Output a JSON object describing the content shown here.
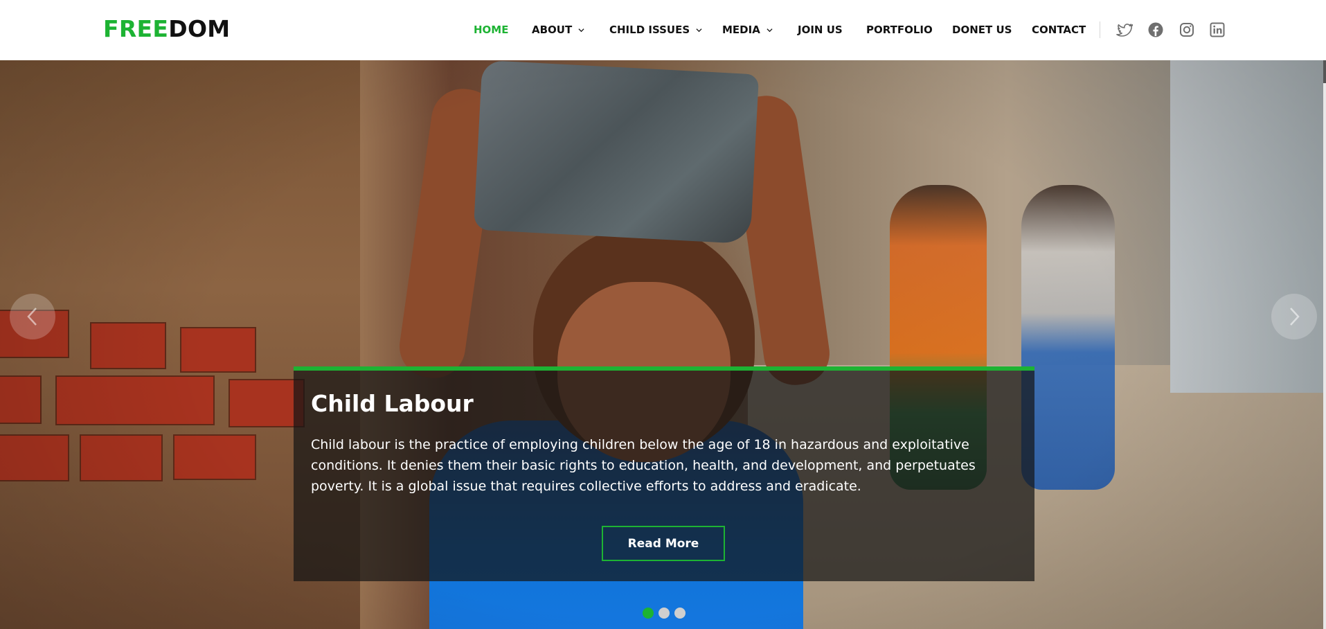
{
  "brand": {
    "part1": "FREE",
    "part2": "DOM",
    "accent": "#1db333"
  },
  "nav": {
    "items": [
      {
        "label": "HOME",
        "active": true,
        "dropdown": false
      },
      {
        "label": "ABOUT",
        "active": false,
        "dropdown": true
      },
      {
        "label": "CHILD ISSUES",
        "active": false,
        "dropdown": true
      },
      {
        "label": "MEDIA",
        "active": false,
        "dropdown": true
      },
      {
        "label": "JOIN US",
        "active": false,
        "dropdown": false
      },
      {
        "label": "PORTFOLIO",
        "active": false,
        "dropdown": false
      },
      {
        "label": "DONET US",
        "active": false,
        "dropdown": false
      },
      {
        "label": "CONTACT",
        "active": false,
        "dropdown": false
      }
    ],
    "social_icons": [
      "twitter-icon",
      "facebook-icon",
      "instagram-icon",
      "linkedin-icon"
    ]
  },
  "hero": {
    "slide": {
      "title": "Child Labour",
      "text": "Child labour is the practice of employing children below the age of 18 in hazardous and exploitative conditions. It denies them their basic rights to education, health, and development, and perpetuates poverty. It is a global issue that requires collective efforts to address and eradicate.",
      "button_label": "Read More"
    },
    "slide_count": 3,
    "active_slide": 1,
    "prev_icon": "chevron-left-icon",
    "next_icon": "chevron-right-icon"
  }
}
